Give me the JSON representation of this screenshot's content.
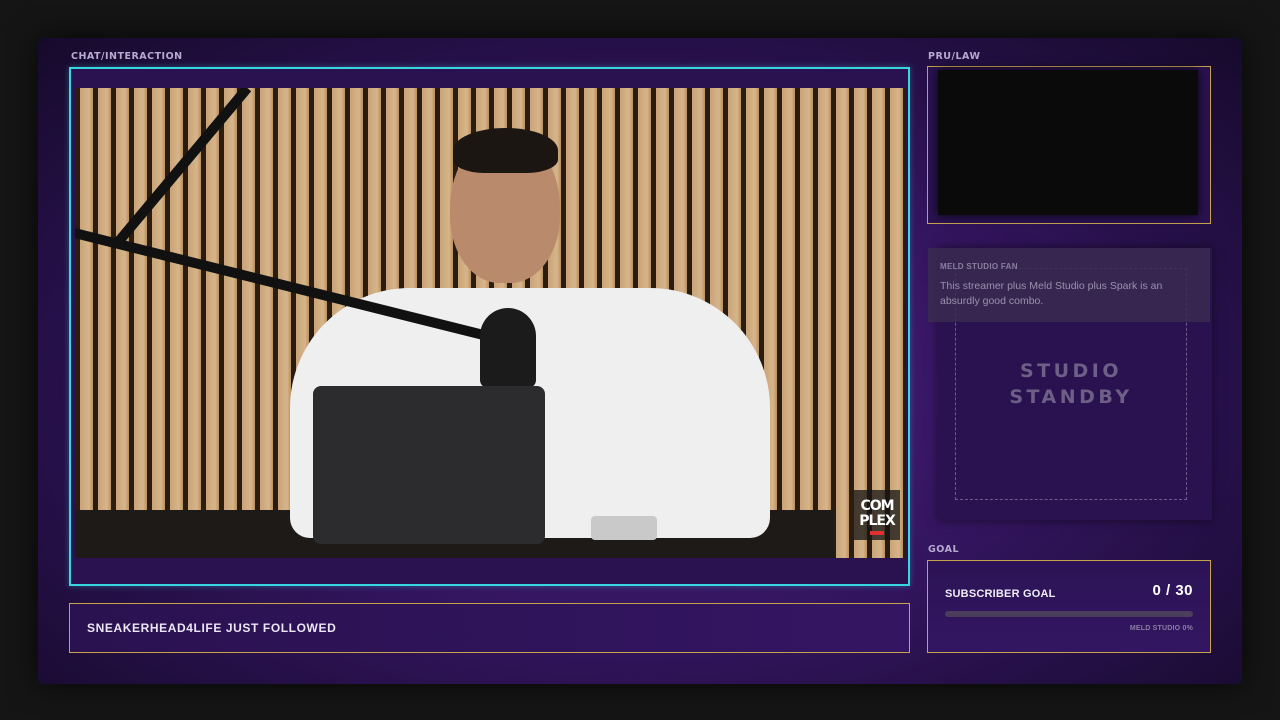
{
  "sections": {
    "chat_label": "CHAT/INTERACTION",
    "cam_label": "PRU/LAW",
    "goal_label": "GOAL"
  },
  "video": {
    "logo_text": "COM PLEX"
  },
  "alert": {
    "text": "SNEAKERHEAD4LIFE JUST FOLLOWED"
  },
  "standby": {
    "line1": "STUDIO",
    "line2": "STANDBY"
  },
  "chat": {
    "username": "MELD STUDIO FAN",
    "message": "This streamer plus Meld Studio plus Spark is an absurdly good combo."
  },
  "goal": {
    "title": "SUBSCRIBER GOAL",
    "count": "0 / 30",
    "current": 0,
    "target": 30,
    "progress_fraction": 0,
    "note": "MELD STUDIO 0%"
  },
  "colors": {
    "accent_cyan": "#38d6e0",
    "accent_gold": "#c9a24c",
    "panel_purple": "#2a1250"
  }
}
